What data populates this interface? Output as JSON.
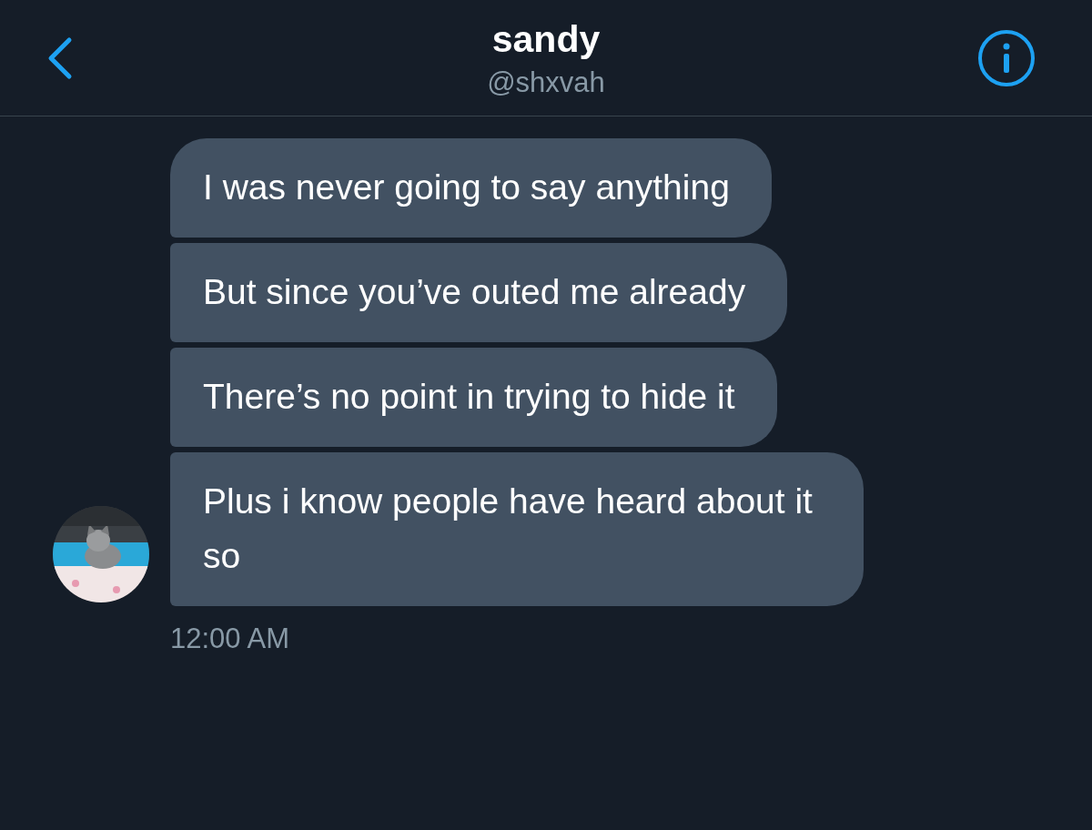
{
  "header": {
    "title": "sandy",
    "handle": "@shxvah"
  },
  "messages": [
    {
      "text": "I was never going to say anything"
    },
    {
      "text": "But since you’ve outed me already"
    },
    {
      "text": "There’s no point in trying to hide it"
    },
    {
      "text": "Plus i know people have heard about it so"
    }
  ],
  "timestamp": "12:00 AM"
}
